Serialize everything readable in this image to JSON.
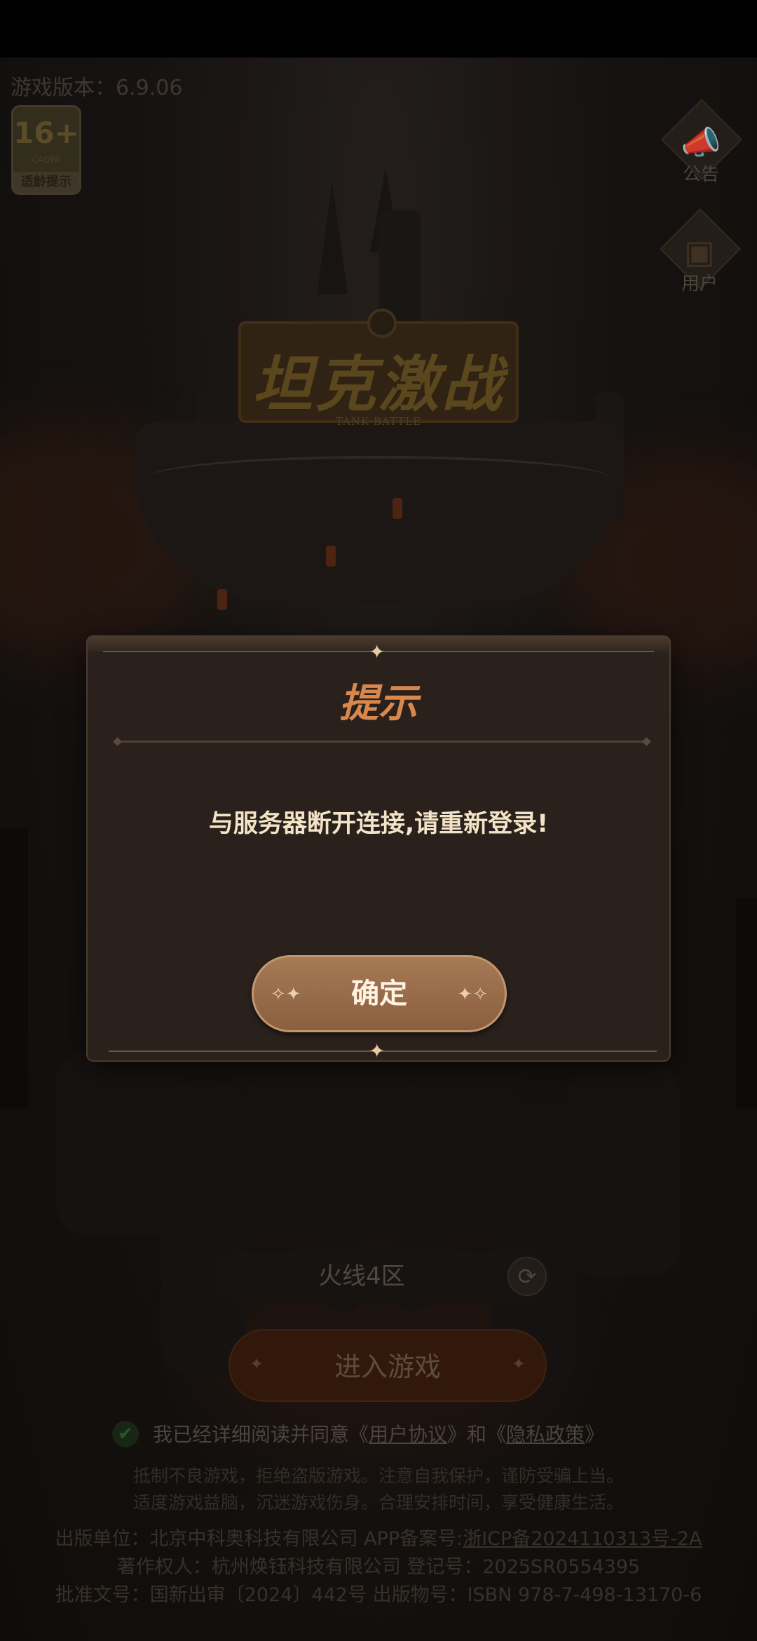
{
  "app": {
    "version_label": "游戏版本：6.9.06",
    "age_rating": {
      "number": "16+",
      "sub": "CADPA",
      "label": "适龄提示"
    }
  },
  "side_buttons": {
    "notice": {
      "label": "公告",
      "icon": "megaphone-icon"
    },
    "user": {
      "label": "用户",
      "icon": "id-card-icon"
    }
  },
  "logo": {
    "title": "坦克激战",
    "subtitle": "TANK BATTLE"
  },
  "dialog": {
    "title": "提示",
    "message": "与服务器断开连接,请重新登录!",
    "confirm_label": "确定"
  },
  "server": {
    "name": "火线4区",
    "icon": "refresh-icon"
  },
  "enter_button": {
    "label": "进入游戏"
  },
  "agreement": {
    "prefix": "我已经详细阅读并同意《",
    "user_agreement": "用户协议",
    "middle": "》和《",
    "privacy_policy": "隐私政策",
    "suffix": "》",
    "checked": true
  },
  "notice_lines": [
    "抵制不良游戏，拒绝盗版游戏。注意自我保护，谨防受骗上当。",
    "适度游戏益脑，沉迷游戏伤身。合理安排时间，享受健康生活。"
  ],
  "publisher": {
    "line1_prefix": "出版单位：北京中科奥科技有限公司   APP备案号:",
    "icp": "浙ICP备2024110313号-2A",
    "line2": "著作权人：杭州焕钰科技有限公司  登记号：2025SR0554395",
    "line3": "批准文号：国新出审〔2024〕442号  出版物号：ISBN 978-7-498-13170-6"
  },
  "colors": {
    "dialog_title": "#d8874d",
    "dialog_bg": "#2a211d",
    "confirm_button": "#9a6c4a"
  }
}
